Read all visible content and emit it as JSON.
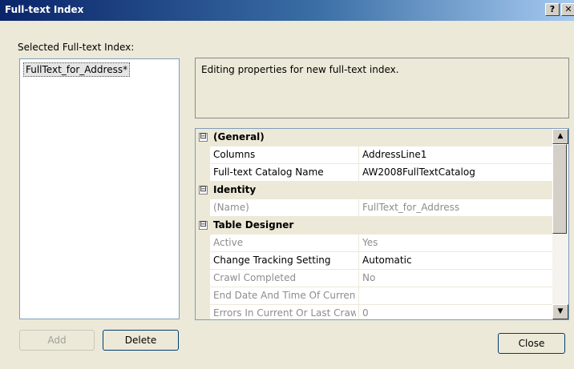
{
  "window": {
    "title": "Full-text Index",
    "help_label": "?",
    "close_label": "✕"
  },
  "left_panel": {
    "label": "Selected Full-text Index:",
    "items": [
      "FullText_for_Address*"
    ]
  },
  "description": "Editing properties for new full-text index.",
  "property_grid": {
    "categories": [
      {
        "name": "(General)",
        "expander": "⊟"
      },
      {
        "name": "Identity",
        "expander": "⊟"
      },
      {
        "name": "Table Designer",
        "expander": "⊟"
      }
    ],
    "properties": [
      {
        "name": "Columns",
        "value": "AddressLine1",
        "readonly": false
      },
      {
        "name": "Full-text Catalog Name",
        "value": "AW2008FullTextCatalog",
        "readonly": false
      },
      {
        "name": "(Name)",
        "value": "FullText_for_Address",
        "readonly": true
      },
      {
        "name": "Active",
        "value": "Yes",
        "readonly": true
      },
      {
        "name": "Change Tracking Setting",
        "value": "Automatic",
        "readonly": false
      },
      {
        "name": "Crawl Completed",
        "value": "No",
        "readonly": true
      },
      {
        "name": "End Date And Time Of Current Or Last Crawl",
        "value": "",
        "readonly": true
      },
      {
        "name": "Errors In Current Or Last Crawl",
        "value": "0",
        "readonly": true
      }
    ],
    "scroll_up": "▲",
    "scroll_down": "▼"
  },
  "buttons": {
    "add": "Add",
    "delete": "Delete",
    "close": "Close"
  }
}
